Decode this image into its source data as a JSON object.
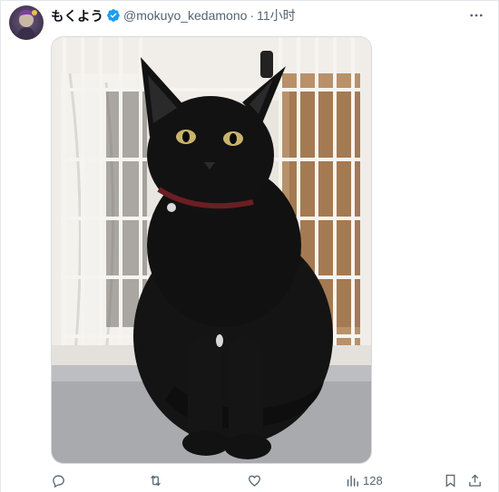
{
  "tweet": {
    "display_name": "もくよう",
    "handle": "@mokuyo_kedamono",
    "separator": "·",
    "time": "11小时"
  },
  "actions": {
    "views_count": "128"
  },
  "colors": {
    "verified_badge": "#1d9bf0",
    "text_primary": "#0f1419",
    "text_secondary": "#536471"
  },
  "icons": [
    "avatar",
    "verified-badge-icon",
    "more-icon",
    "reply-icon",
    "retweet-icon",
    "like-icon",
    "views-icon",
    "bookmark-icon",
    "share-icon"
  ]
}
